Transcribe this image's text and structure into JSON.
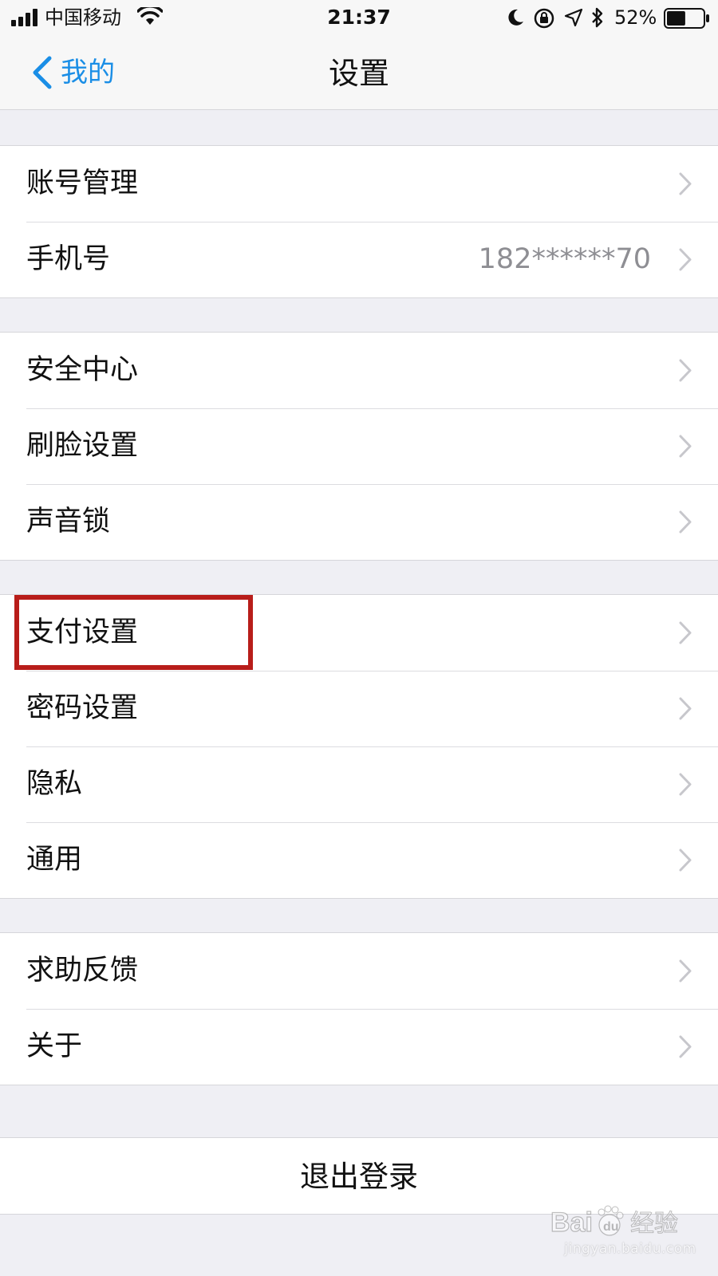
{
  "status_bar": {
    "carrier": "中国移动",
    "time": "21:37",
    "battery_percent": "52%",
    "battery_level": 0.52,
    "icons": [
      "signal-icon",
      "wifi-icon",
      "moon-icon",
      "rotation-lock-icon",
      "location-icon",
      "bluetooth-icon",
      "battery-icon"
    ]
  },
  "nav": {
    "back_label": "我的",
    "title": "设置",
    "accent_color": "#1a8ee6"
  },
  "groups": [
    {
      "rows": [
        {
          "label": "账号管理",
          "value": ""
        },
        {
          "label": "手机号",
          "value": "182******70"
        }
      ]
    },
    {
      "rows": [
        {
          "label": "安全中心",
          "value": ""
        },
        {
          "label": "刷脸设置",
          "value": ""
        },
        {
          "label": "声音锁",
          "value": ""
        }
      ]
    },
    {
      "rows": [
        {
          "label": "支付设置",
          "value": "",
          "highlighted": true
        },
        {
          "label": "密码设置",
          "value": ""
        },
        {
          "label": "隐私",
          "value": ""
        },
        {
          "label": "通用",
          "value": ""
        }
      ]
    },
    {
      "rows": [
        {
          "label": "求助反馈",
          "value": ""
        },
        {
          "label": "关于",
          "value": ""
        }
      ]
    }
  ],
  "logout_label": "退出登录",
  "highlight_color": "#b81d1a",
  "watermark": {
    "brand": "Baidu经验",
    "url": "jingyan.baidu.com"
  }
}
